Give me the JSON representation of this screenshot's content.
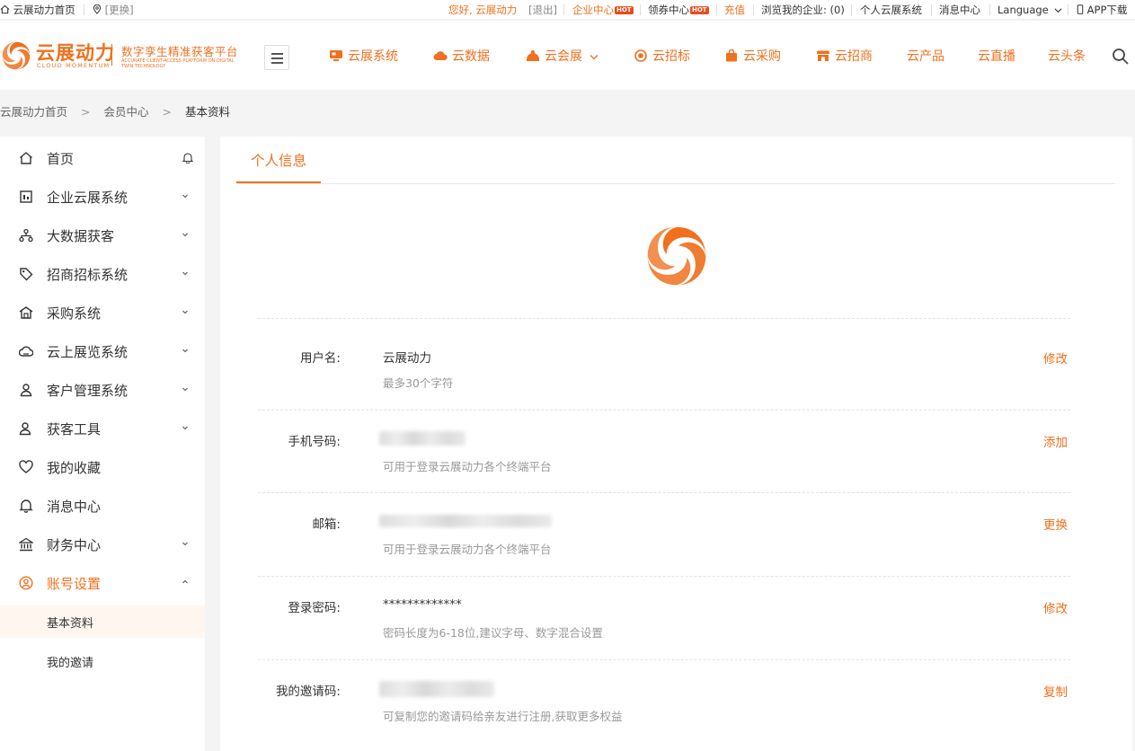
{
  "topbar": {
    "home": "云展动力首页",
    "change": "[更换]",
    "greeting": "您好, 云展动力",
    "logout": "[退出]",
    "enterprise_center": "企业中心",
    "hot": "HOT",
    "coupon_center": "领券中心",
    "recharge": "充值",
    "browse_enterprise": "浏览我的企业: (0)",
    "personal_system": "个人云展系统",
    "message_center": "消息中心",
    "language": "Language",
    "app_download": "APP下载"
  },
  "header": {
    "logo_cn": "云展动力",
    "logo_en": "CLOUD MOMENTUM",
    "slogan": "数字孪生精准获客平台",
    "slogan_en": "ACCURATE CLIENT-ACCESS PLATFORM ON DIGITAL TWIN TECHNOLOGY",
    "nav": [
      {
        "label": "云展系统"
      },
      {
        "label": "云数据"
      },
      {
        "label": "云会展"
      },
      {
        "label": "云招标"
      },
      {
        "label": "云采购"
      },
      {
        "label": "云招商"
      },
      {
        "label": "云产品"
      },
      {
        "label": "云直播"
      },
      {
        "label": "云头条"
      }
    ]
  },
  "breadcrumb": {
    "items": [
      "云展动力首页",
      "会员中心",
      "基本资料"
    ],
    "separator": ">"
  },
  "sidebar": {
    "items": [
      {
        "label": "首页"
      },
      {
        "label": "企业云展系统"
      },
      {
        "label": "大数据获客"
      },
      {
        "label": "招商招标系统"
      },
      {
        "label": "采购系统"
      },
      {
        "label": "云上展览系统"
      },
      {
        "label": "客户管理系统"
      },
      {
        "label": "获客工具"
      },
      {
        "label": "我的收藏"
      },
      {
        "label": "消息中心"
      },
      {
        "label": "财务中心"
      },
      {
        "label": "账号设置"
      }
    ],
    "sub_items": [
      {
        "label": "基本资料"
      },
      {
        "label": "我的邀请"
      }
    ]
  },
  "main": {
    "tab": "个人信息",
    "rows": [
      {
        "label": "用户名:",
        "value": "云展动力",
        "hint": "最多30个字符",
        "action": "修改"
      },
      {
        "label": "手机号码:",
        "value": "",
        "hint": "可用于登录云展动力各个终端平台",
        "action": "添加"
      },
      {
        "label": "邮箱:",
        "value": "",
        "hint": "可用于登录云展动力各个终端平台",
        "action": "更换"
      },
      {
        "label": "登录密码:",
        "value": "*************",
        "hint": "密码长度为6-18位,建议字母、数字混合设置",
        "action": "修改"
      },
      {
        "label": "我的邀请码:",
        "value": "",
        "hint": "可复制您的邀请码给亲友进行注册,获取更多权益",
        "action": "复制"
      }
    ]
  },
  "colors": {
    "accent": "#f0701e",
    "hot_badge": "#e84c1b",
    "selected_bg": "#fff6f0",
    "page_bg": "#f4f4f4"
  }
}
